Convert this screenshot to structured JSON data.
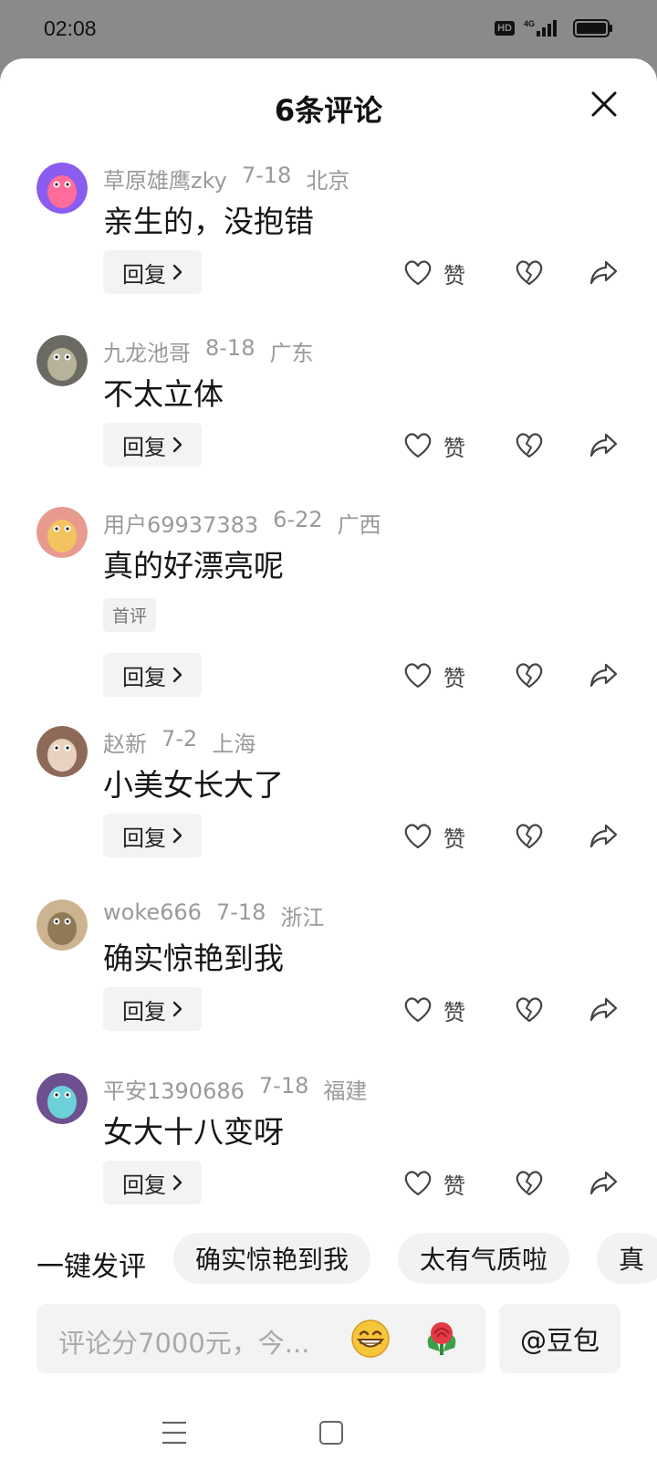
{
  "status_bar": {
    "time": "02:08",
    "hd": "HD",
    "network": "4G"
  },
  "sheet": {
    "title": "6条评论"
  },
  "comments": [
    {
      "user": "草原雄鹰zky",
      "date": "7-18",
      "location": "北京",
      "text": "亲生的，没抱错",
      "reply": "回复",
      "like": "赞",
      "tag": ""
    },
    {
      "user": "九龙池哥",
      "date": "8-18",
      "location": "广东",
      "text": "不太立体",
      "reply": "回复",
      "like": "赞",
      "tag": ""
    },
    {
      "user": "用户69937383",
      "date": "6-22",
      "location": "广西",
      "text": "真的好漂亮呢",
      "reply": "回复",
      "like": "赞",
      "tag": "首评"
    },
    {
      "user": "赵新",
      "date": "7-2",
      "location": "上海",
      "text": "小美女长大了",
      "reply": "回复",
      "like": "赞",
      "tag": ""
    },
    {
      "user": "woke666",
      "date": "7-18",
      "location": "浙江",
      "text": "确实惊艳到我",
      "reply": "回复",
      "like": "赞",
      "tag": ""
    },
    {
      "user": "平安1390686",
      "date": "7-18",
      "location": "福建",
      "text": "女大十八变呀",
      "reply": "回复",
      "like": "赞",
      "tag": ""
    }
  ],
  "quick_comment": {
    "label": "一键发评",
    "chips": [
      "确实惊艳到我",
      "太有气质啦",
      "真"
    ]
  },
  "input": {
    "placeholder": "评论分7000元，今..."
  },
  "doubao_button": "@豆包",
  "colors": {
    "accent_red": "#e8404a",
    "text_gray": "#9a9a9a",
    "chip_bg": "#f2f2f2"
  },
  "icons": [
    "close-icon",
    "like-heart-icon",
    "dislike-heart-icon",
    "share-icon",
    "chevron-right-icon",
    "grin-emoji-icon",
    "rose-icon"
  ]
}
